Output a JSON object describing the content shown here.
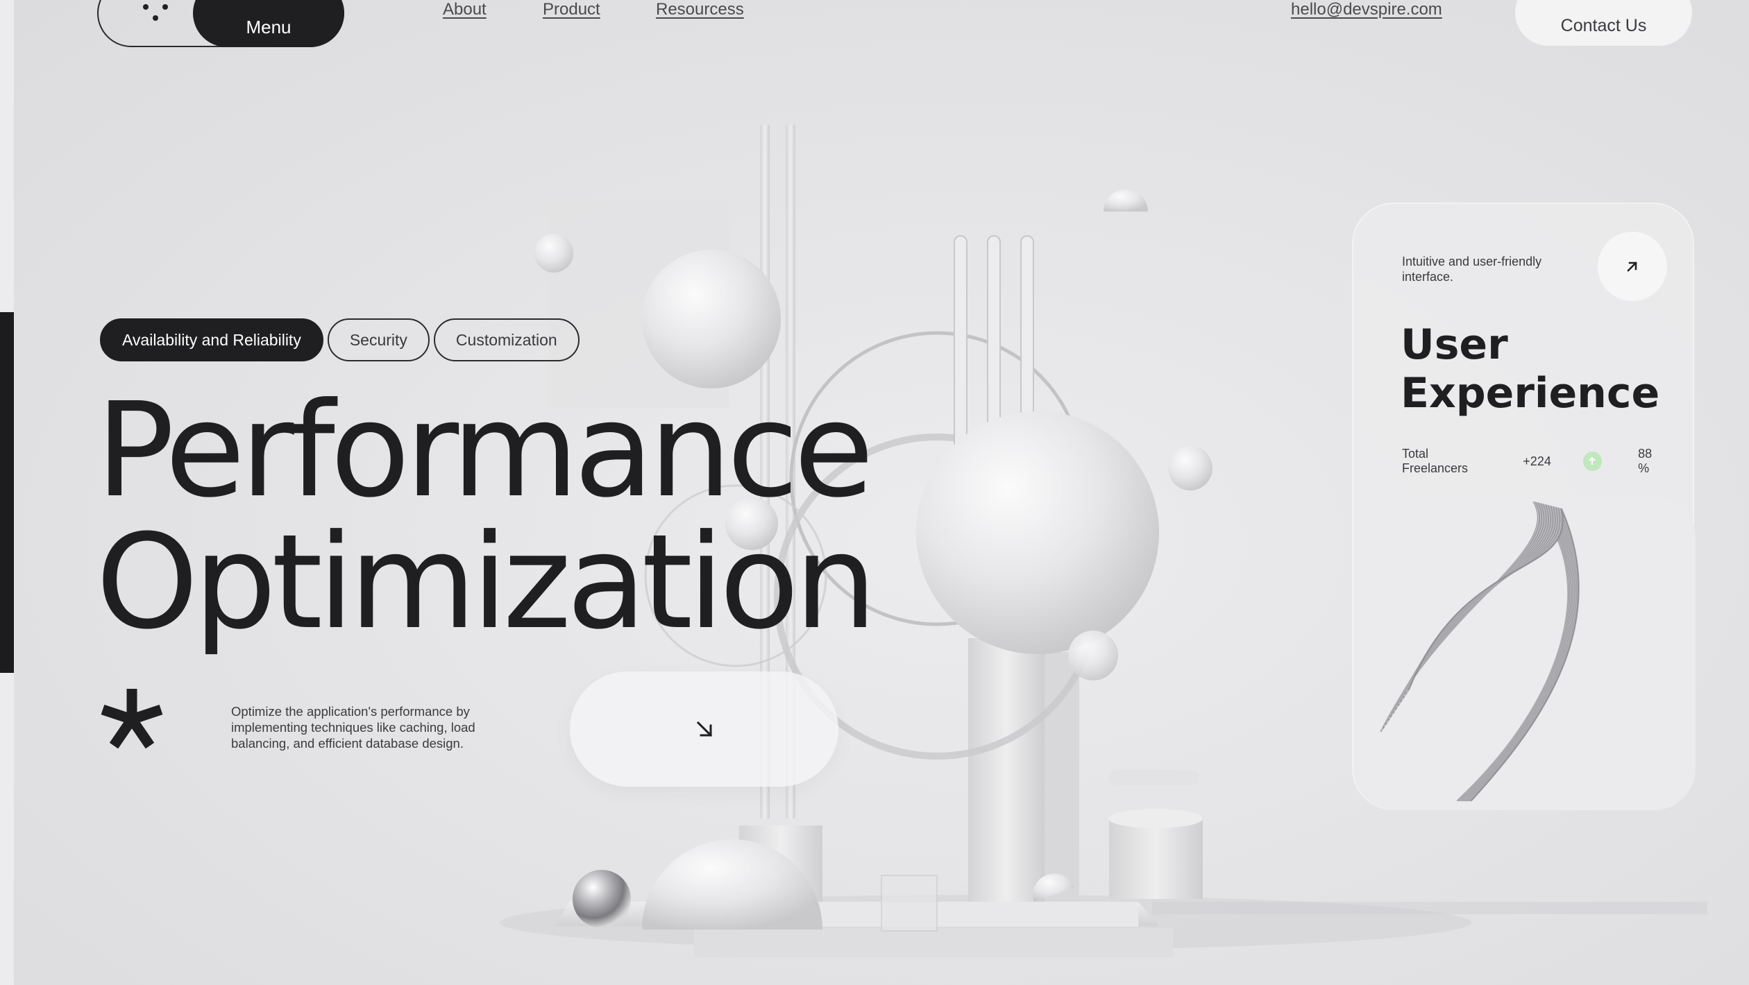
{
  "nav": {
    "menu_label": "Menu",
    "links": [
      {
        "label": "About"
      },
      {
        "label": "Product"
      },
      {
        "label": "Resourcess"
      }
    ],
    "email": "hello@devspire.com",
    "contact_label": "Contact Us"
  },
  "hero": {
    "tags": [
      {
        "label": "Availability and Reliability",
        "active": true
      },
      {
        "label": "Security",
        "active": false
      },
      {
        "label": "Customization",
        "active": false
      }
    ],
    "title_line1": "Performance",
    "title_line2": "Optimization",
    "description": "Optimize the application's performance by implementing techniques like caching, load balancing, and efficient database design."
  },
  "card": {
    "subtitle": "Intuitive and user-friendly interface.",
    "title": "User Experience",
    "stat_label": "Total Freelancers",
    "stat_value": "+224",
    "stat_percent": "88 %"
  },
  "colors": {
    "background": "#e4e4e6",
    "dark": "#1f1f21",
    "accent_green": "#bfe8bc"
  },
  "icons": {
    "logo": "dots-logo-icon",
    "hero_button": "arrow-down-right-icon",
    "card_button": "arrow-up-right-icon",
    "stat": "arrow-up-icon",
    "decoration": "asterisk-icon"
  }
}
